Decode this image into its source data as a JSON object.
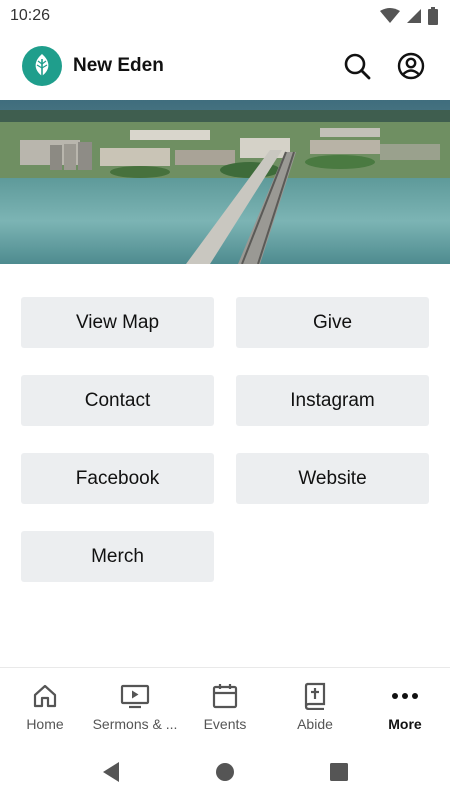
{
  "status_bar": {
    "time": "10:26"
  },
  "app": {
    "title": "New Eden"
  },
  "buttons": [
    {
      "label": "View Map"
    },
    {
      "label": "Give"
    },
    {
      "label": "Contact"
    },
    {
      "label": "Instagram"
    },
    {
      "label": "Facebook"
    },
    {
      "label": "Website"
    },
    {
      "label": "Merch"
    }
  ],
  "bottom_nav": [
    {
      "label": "Home",
      "icon": "home-icon"
    },
    {
      "label": "Sermons & ...",
      "icon": "video-icon"
    },
    {
      "label": "Events",
      "icon": "calendar-icon"
    },
    {
      "label": "Abide",
      "icon": "bible-icon"
    },
    {
      "label": "More",
      "icon": "more-icon",
      "active": true
    }
  ],
  "colors": {
    "brand": "#1f9e8c",
    "button_bg": "#eceef0"
  }
}
